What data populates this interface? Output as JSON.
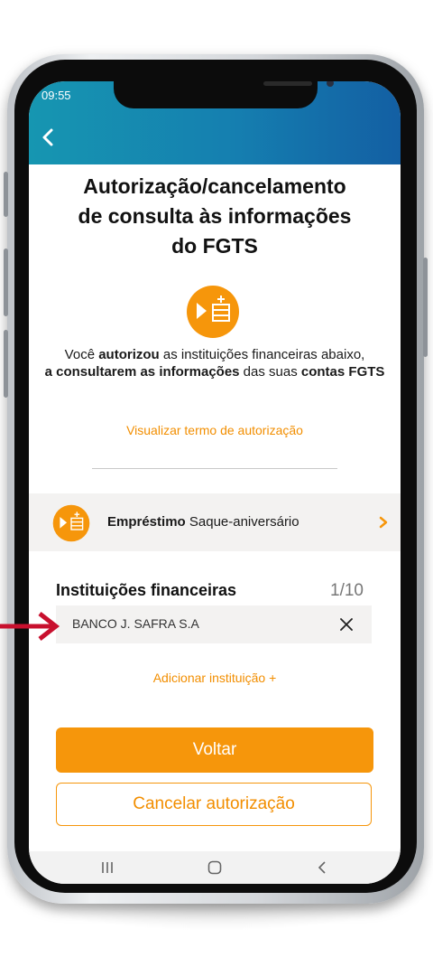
{
  "status_bar": {
    "time": "09:55"
  },
  "header": {
    "back_icon": "chevron-left-icon"
  },
  "page": {
    "title_lines": [
      "Autorização/cancelamento",
      "de consulta às informações",
      "do FGTS"
    ],
    "description": {
      "p1": "Você ",
      "b1": "autorizou",
      "p2": " as instituições financeiras abaixo,",
      "b2": "a consultarem as informações",
      "p3": " das suas ",
      "b3": "contas FGTS"
    },
    "terms_link": "Visualizar termo de autorização"
  },
  "product": {
    "name": "Empréstimo",
    "detail": "Saque-aniversário",
    "icon": "play-cash-icon"
  },
  "institutions": {
    "title": "Instituições financeiras",
    "count": "1/10",
    "items": [
      {
        "name": "BANCO J. SAFRA S.A"
      }
    ],
    "add_label": "Adicionar instituição +"
  },
  "actions": {
    "back_label": "Voltar",
    "cancel_label": "Cancelar autorização"
  },
  "colors": {
    "accent": "#f6960b",
    "header_start": "#1696b1",
    "header_end": "#135fa3",
    "pointer": "#c8102e"
  }
}
